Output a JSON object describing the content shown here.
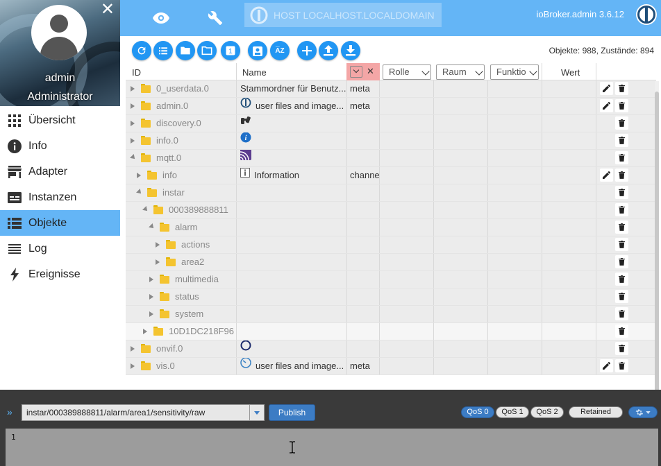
{
  "sidebar": {
    "user_name": "admin",
    "user_role": "Administrator",
    "items": [
      {
        "label": "Übersicht",
        "icon": "grid-icon",
        "active": false
      },
      {
        "label": "Info",
        "icon": "info-icon",
        "active": false
      },
      {
        "label": "Adapter",
        "icon": "store-icon",
        "active": false
      },
      {
        "label": "Instanzen",
        "icon": "instances-icon",
        "active": false
      },
      {
        "label": "Objekte",
        "icon": "list-icon",
        "active": true
      },
      {
        "label": "Log",
        "icon": "log-icon",
        "active": false
      },
      {
        "label": "Ereignisse",
        "icon": "bolt-icon",
        "active": false
      }
    ]
  },
  "topbar": {
    "host": "HOST LOCALHOST.LOCALDOMAIN",
    "version": "ioBroker.admin 3.6.12"
  },
  "toolbar": {
    "object_count": "Objekte: 988, Zustände: 894",
    "colors": {
      "button": "#2196f3",
      "accent": "#64b5f6"
    }
  },
  "table": {
    "headers": {
      "id": "ID",
      "name": "Name",
      "role": "Rolle",
      "room": "Raum",
      "function": "Funktio",
      "value": "Wert"
    },
    "rows": [
      {
        "id": "0_userdata.0",
        "name": "Stammordner für Benutz...",
        "type": "meta",
        "depth": 0,
        "expander": "closed",
        "edit": true,
        "name_icon": ""
      },
      {
        "id": "admin.0",
        "name": "user files and image...",
        "type": "meta",
        "depth": 0,
        "expander": "closed",
        "edit": true,
        "name_icon": "iobroker-icon"
      },
      {
        "id": "discovery.0",
        "name": "",
        "type": "",
        "depth": 0,
        "expander": "closed",
        "edit": false,
        "name_icon": "binoculars-icon"
      },
      {
        "id": "info.0",
        "name": "",
        "type": "",
        "depth": 0,
        "expander": "closed",
        "edit": false,
        "name_icon": "info-circle-icon"
      },
      {
        "id": "mqtt.0",
        "name": "",
        "type": "",
        "depth": 0,
        "expander": "open",
        "edit": false,
        "name_icon": "mqtt-icon"
      },
      {
        "id": "info",
        "name": "Information",
        "type": "channe",
        "depth": 1,
        "expander": "closed",
        "edit": true,
        "name_icon": "info-box-icon"
      },
      {
        "id": "instar",
        "name": "",
        "type": "",
        "depth": 1,
        "expander": "open",
        "edit": false,
        "name_icon": ""
      },
      {
        "id": "000389888811",
        "name": "",
        "type": "",
        "depth": 2,
        "expander": "open",
        "edit": false,
        "name_icon": ""
      },
      {
        "id": "alarm",
        "name": "",
        "type": "",
        "depth": 3,
        "expander": "open",
        "edit": false,
        "name_icon": ""
      },
      {
        "id": "actions",
        "name": "",
        "type": "",
        "depth": 4,
        "expander": "closed",
        "edit": false,
        "name_icon": ""
      },
      {
        "id": "area2",
        "name": "",
        "type": "",
        "depth": 4,
        "expander": "closed",
        "edit": false,
        "name_icon": ""
      },
      {
        "id": "multimedia",
        "name": "",
        "type": "",
        "depth": 3,
        "expander": "closed",
        "edit": false,
        "name_icon": ""
      },
      {
        "id": "status",
        "name": "",
        "type": "",
        "depth": 3,
        "expander": "closed",
        "edit": false,
        "name_icon": ""
      },
      {
        "id": "system",
        "name": "",
        "type": "",
        "depth": 3,
        "expander": "closed",
        "edit": false,
        "name_icon": ""
      },
      {
        "id": "10D1DC218F96",
        "name": "",
        "type": "",
        "depth": 2,
        "expander": "closed",
        "edit": false,
        "name_icon": "",
        "plain": true
      },
      {
        "id": "onvif.0",
        "name": "",
        "type": "",
        "depth": 0,
        "expander": "closed",
        "edit": false,
        "name_icon": "onvif-icon"
      },
      {
        "id": "vis.0",
        "name": "user files and image...",
        "type": "meta",
        "depth": 0,
        "expander": "closed",
        "edit": true,
        "name_icon": "vis-icon"
      }
    ]
  },
  "publish_panel": {
    "topic": "instar/000389888811/alarm/area1/sensitivity/raw",
    "publish_label": "Publish",
    "qos": [
      "QoS 0",
      "QoS 1",
      "QoS 2"
    ],
    "qos_selected": "QoS 0",
    "retained_label": "Retained",
    "message": "1"
  }
}
